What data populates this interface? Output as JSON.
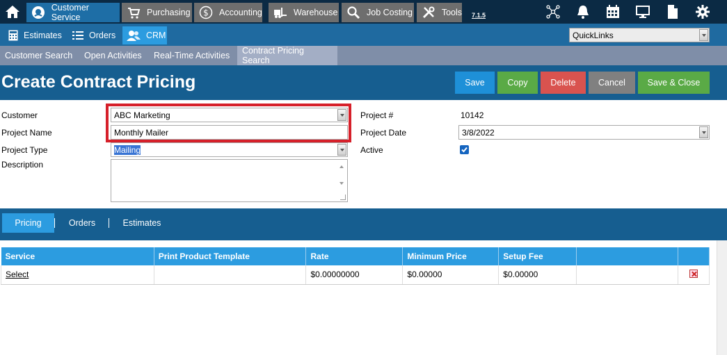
{
  "topnav": {
    "tabs": [
      {
        "label": "Customer Service",
        "icon": "headset-icon",
        "active": true
      },
      {
        "label": "Purchasing",
        "icon": "cart-icon"
      },
      {
        "label": "Accounting",
        "icon": "dollar-icon"
      },
      {
        "label": "Warehouse",
        "icon": "forklift-icon"
      },
      {
        "label": "Job Costing",
        "icon": "magnifier-icon"
      },
      {
        "label": "Tools",
        "icon": "tools-icon"
      }
    ],
    "version": "7.1.5",
    "right_icons": [
      "network-icon",
      "bell-icon",
      "calendar-icon",
      "monitor-icon",
      "document-icon",
      "gear-icon"
    ]
  },
  "subnav": {
    "items": [
      {
        "label": "Estimates",
        "icon": "calculator-icon"
      },
      {
        "label": "Orders",
        "icon": "list-icon"
      },
      {
        "label": "CRM",
        "icon": "users-icon",
        "active": true
      }
    ],
    "quicklinks": "QuickLinks"
  },
  "thirdnav": {
    "items": [
      "Customer Search",
      "Open Activities",
      "Real-Time Activities",
      "Contract Pricing Search"
    ],
    "active": "Contract Pricing Search"
  },
  "page": {
    "title": "Create Contract Pricing",
    "buttons": {
      "save": "Save",
      "copy": "Copy",
      "delete": "Delete",
      "cancel": "Cancel",
      "save_close": "Save & Close"
    }
  },
  "form": {
    "customer_label": "Customer",
    "customer_value": "ABC Marketing",
    "project_name_label": "Project Name",
    "project_name_value": "Monthly Mailer",
    "project_type_label": "Project Type",
    "project_type_value": "Mailing",
    "description_label": "Description",
    "project_num_label": "Project #",
    "project_num_value": "10142",
    "project_date_label": "Project Date",
    "project_date_value": "3/8/2022",
    "active_label": "Active",
    "active_checked": true
  },
  "tabs": {
    "items": [
      "Pricing",
      "Orders",
      "Estimates"
    ],
    "active": "Pricing"
  },
  "grid": {
    "headers": [
      "Service",
      "Print Product Template",
      "Rate",
      "Minimum Price",
      "Setup Fee",
      ""
    ],
    "rows": [
      {
        "service": "Select",
        "template": "",
        "rate": "$0.00000000",
        "min_price": "$0.00000",
        "setup_fee": "$0.00000",
        "extra": ""
      }
    ]
  },
  "colors": {
    "topnav_bg": "#0b2a44",
    "accent": "#2c9ce0",
    "save": "#1e90d8",
    "copy": "#5aaa46",
    "delete": "#d9534f",
    "cancel": "#808080",
    "save_close": "#5aaa46",
    "highlight": "#d6202a"
  }
}
